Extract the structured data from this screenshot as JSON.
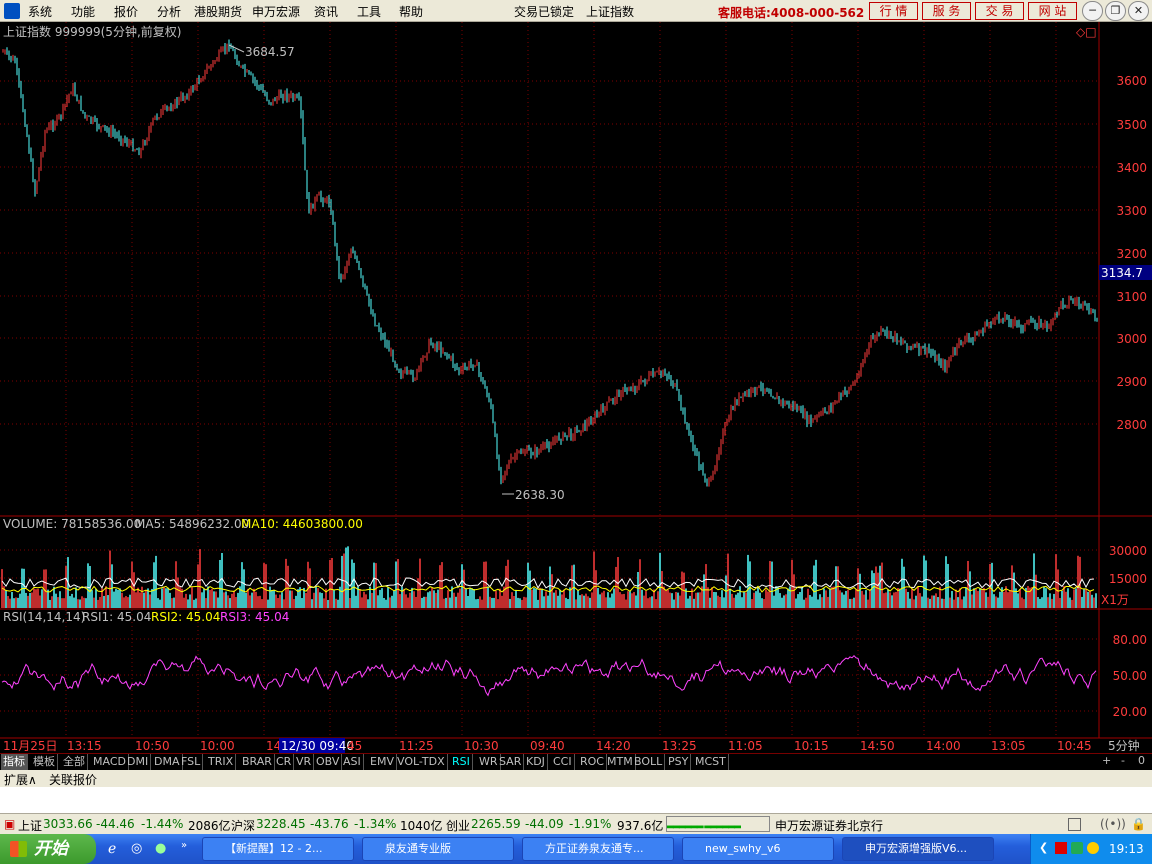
{
  "menubar": {
    "items": [
      "系统",
      "功能",
      "报价",
      "分析",
      "港股期货",
      "申万宏源",
      "资讯",
      "工具",
      "帮助"
    ],
    "lock_status": "交易已锁定",
    "current_index": "上证指数",
    "phone": "客服电话:4008-000-562",
    "buttons": [
      "行 情",
      "服 务",
      "交 易",
      "网 站"
    ]
  },
  "chart": {
    "main_title": "上证指数 999999(5分钟,前复权)",
    "high_label": "3684.57",
    "low_label": "2638.30",
    "current_price": "3134.7",
    "price_axis": [
      "3600",
      "3500",
      "3400",
      "3300",
      "3200",
      "3100",
      "3000",
      "2900",
      "2800"
    ],
    "volume_title": "VOLUME: 78158536.00",
    "ma5_label": "MA5: 54896232.00",
    "ma10_label": "MA10: 44603800.00",
    "volume_axis": [
      "30000",
      "15000"
    ],
    "volume_unit": "X1万",
    "rsi_title": "RSI(14,14,14)",
    "rsi1_label": "RSI1: 45.04",
    "rsi2_label": "RSI2: 45.04",
    "rsi3_label": "RSI3: 45.04",
    "rsi_axis": [
      "80.00",
      "50.00",
      "20.00"
    ],
    "time_axis": [
      "11月25日",
      "13:15",
      "10:50",
      "10:00",
      "14",
      "12/30 09:40",
      "45",
      "11:25",
      "10:30",
      "09:40",
      "14:20",
      "13:25",
      "11:05",
      "10:15",
      "14:50",
      "14:00",
      "13:05",
      "10:45"
    ],
    "period": "5分钟",
    "colors": {
      "up": "#ff3c3c",
      "down": "#54ffff",
      "ma5": "#ffffff",
      "ma10": "#ffff00",
      "rsi": "#ff44ff",
      "grid": "#800000"
    }
  },
  "indicator_tabs": [
    "指标",
    "模板",
    "全部",
    "MACD",
    "DMI",
    "DMA",
    "FSL",
    "TRIX",
    "BRAR",
    "CR",
    "VR",
    "OBV",
    "ASI",
    "EMV",
    "VOL-TDX",
    "RSI",
    "WR",
    "SAR",
    "KDJ",
    "CCI",
    "ROC",
    "MTM",
    "BOLL",
    "PSY",
    "MCST"
  ],
  "active_tab": "RSI",
  "zoom_controls": [
    "+",
    "-",
    "0"
  ],
  "ext_links": [
    "扩展∧",
    "关联报价"
  ],
  "status": {
    "sh_name": "上证",
    "sh_price": "3033.66",
    "sh_chg": "-44.46",
    "sh_pct": "-1.44%",
    "sh_amt": "2086亿",
    "hs_name": "沪深",
    "hs_price": "3228.45",
    "hs_chg": "-43.76",
    "hs_pct": "-1.34%",
    "hs_amt": "1040亿",
    "cy_name": "创业",
    "cy_price": "2265.59",
    "cy_chg": "-44.09",
    "cy_pct": "-1.91%",
    "cy_amt": "937.6亿",
    "broker": "申万宏源证券北京行"
  },
  "taskbar": {
    "start": "开始",
    "windows": [
      "【新提醒】12 - 2...",
      "泉友通专业版",
      "方正证券泉友通专...",
      "new_swhy_v6",
      "申万宏源增强版V6..."
    ],
    "clock": "19:13"
  }
}
